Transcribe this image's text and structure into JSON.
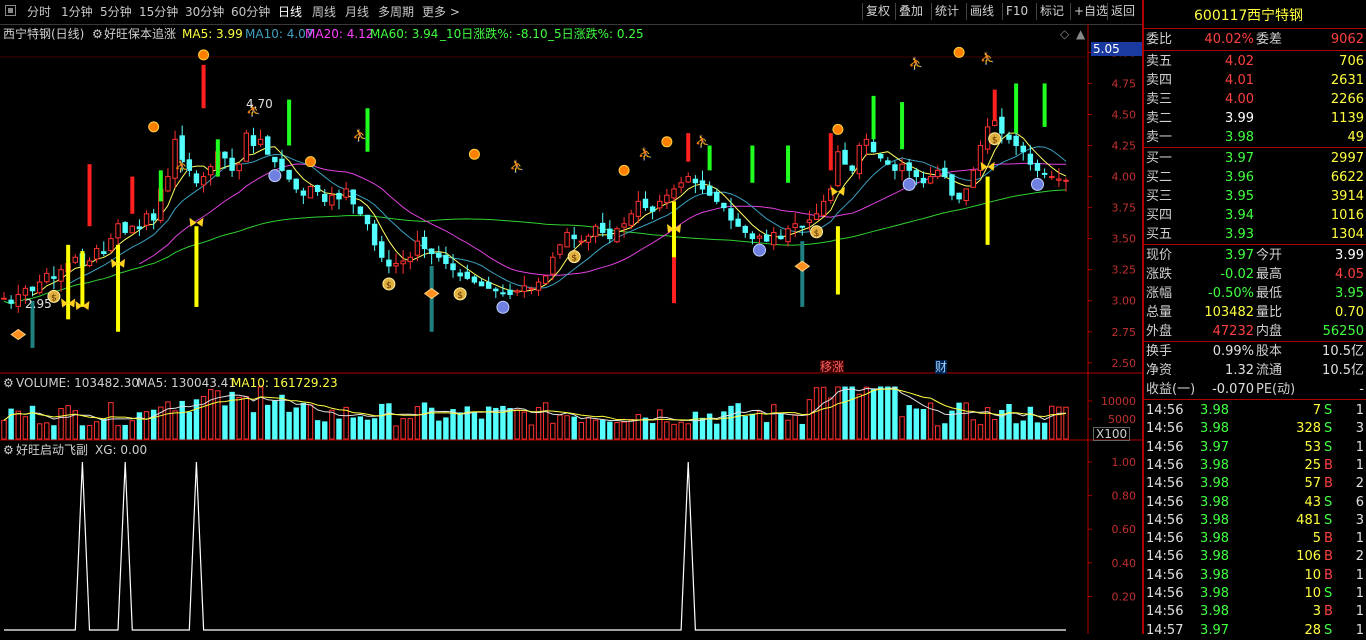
{
  "toolbar": {
    "periods": [
      "分时",
      "1分钟",
      "5分钟",
      "15分钟",
      "30分钟",
      "60分钟",
      "日线",
      "周线",
      "月线",
      "多周期",
      "更多"
    ],
    "active_period": "日线",
    "right_buttons": [
      "复权",
      "叠加",
      "统计",
      "画线",
      "F10",
      "标记",
      "+自选",
      "返回"
    ]
  },
  "main_chart": {
    "stock_title": "西宁特钢(日线)",
    "indicator_name": "好旺保本追涨",
    "ma_values": [
      {
        "label": "MA5: 3.99",
        "color": "#ffff40"
      },
      {
        "label": "MA10: 4.07",
        "color": "#40a0c0"
      },
      {
        "label": "MA20: 4.12",
        "color": "#ff40ff"
      },
      {
        "label": "MA60: 3.94",
        "color": "#40ff40"
      },
      {
        "label": "_10日涨跌%: -8.10",
        "color": "#40ff40"
      },
      {
        "label": "_5日涨跌%: 0.25",
        "color": "#40ff40"
      }
    ],
    "price_axis": [
      "5.00",
      "4.75",
      "4.50",
      "4.25",
      "4.00",
      "3.75",
      "3.50",
      "3.25",
      "3.00",
      "2.75",
      "2.50"
    ],
    "current_price_tag": "5.05",
    "high_label": "4.70",
    "low_label": "2.95",
    "event_tags": [
      "移涨",
      "财"
    ]
  },
  "volume_chart": {
    "title": "VOLUME: 103482.30",
    "ma5": "MA5: 130043.41",
    "ma10": "MA10: 161729.23",
    "axis": [
      "10000",
      "5000"
    ],
    "unit": "X100"
  },
  "sub_chart": {
    "title": "好旺启动飞副",
    "xg": "XG: 0.00",
    "axis": [
      "1.00",
      "0.80",
      "0.60",
      "0.40",
      "0.20"
    ]
  },
  "quote": {
    "code": "600117",
    "name": "西宁特钢",
    "weibi_label": "委比",
    "weibi_value": "40.02%",
    "weicha_label": "委差",
    "weicha_value": "9062",
    "asks": [
      {
        "label": "卖五",
        "price": "4.02",
        "vol": "706",
        "pc": "#ff4040"
      },
      {
        "label": "卖四",
        "price": "4.01",
        "vol": "2631",
        "pc": "#ff4040"
      },
      {
        "label": "卖三",
        "price": "4.00",
        "vol": "2266",
        "pc": "#ff4040"
      },
      {
        "label": "卖二",
        "price": "3.99",
        "vol": "1139",
        "pc": "#ffffff"
      },
      {
        "label": "卖一",
        "price": "3.98",
        "vol": "49",
        "pc": "#40ff40"
      }
    ],
    "bids": [
      {
        "label": "买一",
        "price": "3.97",
        "vol": "2997",
        "pc": "#40ff40"
      },
      {
        "label": "买二",
        "price": "3.96",
        "vol": "6622",
        "pc": "#40ff40"
      },
      {
        "label": "买三",
        "price": "3.95",
        "vol": "3914",
        "pc": "#40ff40"
      },
      {
        "label": "买四",
        "price": "3.94",
        "vol": "1016",
        "pc": "#40ff40"
      },
      {
        "label": "买五",
        "price": "3.93",
        "vol": "1304",
        "pc": "#40ff40"
      }
    ],
    "stats": [
      {
        "l1": "现价",
        "v1": "3.97",
        "c1": "#40ff40",
        "l2": "今开",
        "v2": "3.99",
        "c2": "#ffffff"
      },
      {
        "l1": "涨跌",
        "v1": "-0.02",
        "c1": "#40ff40",
        "l2": "最高",
        "v2": "4.05",
        "c2": "#ff4040"
      },
      {
        "l1": "涨幅",
        "v1": "-0.50%",
        "c1": "#40ff40",
        "l2": "最低",
        "v2": "3.95",
        "c2": "#40ff40"
      },
      {
        "l1": "总量",
        "v1": "103482",
        "c1": "#ffff40",
        "l2": "量比",
        "v2": "0.70",
        "c2": "#ffff40"
      },
      {
        "l1": "外盘",
        "v1": "47232",
        "c1": "#ff4040",
        "l2": "内盘",
        "v2": "56250",
        "c2": "#40ff40"
      }
    ],
    "stats2": [
      {
        "l1": "换手",
        "v1": "0.99%",
        "l2": "股本",
        "v2": "10.5亿"
      },
      {
        "l1": "净资",
        "v1": "1.32",
        "l2": "流通",
        "v2": "10.5亿"
      },
      {
        "l1": "收益(一)",
        "v1": "-0.070",
        "l2": "PE(动)",
        "v2": "-"
      }
    ],
    "ticks": [
      {
        "time": "14:56",
        "price": "3.98",
        "vol": "7",
        "bs": "S",
        "n": "1"
      },
      {
        "time": "14:56",
        "price": "3.98",
        "vol": "328",
        "bs": "S",
        "n": "3"
      },
      {
        "time": "14:56",
        "price": "3.97",
        "vol": "53",
        "bs": "S",
        "n": "1"
      },
      {
        "time": "14:56",
        "price": "3.98",
        "vol": "25",
        "bs": "B",
        "n": "1"
      },
      {
        "time": "14:56",
        "price": "3.98",
        "vol": "57",
        "bs": "B",
        "n": "2"
      },
      {
        "time": "14:56",
        "price": "3.98",
        "vol": "43",
        "bs": "S",
        "n": "6"
      },
      {
        "time": "14:56",
        "price": "3.98",
        "vol": "481",
        "bs": "S",
        "n": "3"
      },
      {
        "time": "14:56",
        "price": "3.98",
        "vol": "5",
        "bs": "B",
        "n": "1"
      },
      {
        "time": "14:56",
        "price": "3.98",
        "vol": "106",
        "bs": "B",
        "n": "2"
      },
      {
        "time": "14:56",
        "price": "3.98",
        "vol": "10",
        "bs": "B",
        "n": "1"
      },
      {
        "time": "14:56",
        "price": "3.98",
        "vol": "10",
        "bs": "S",
        "n": "1"
      },
      {
        "time": "14:56",
        "price": "3.98",
        "vol": "3",
        "bs": "B",
        "n": "1"
      },
      {
        "time": "14:57",
        "price": "3.97",
        "vol": "28",
        "bs": "S",
        "n": "1"
      }
    ]
  },
  "chart_data": {
    "type": "candlestick",
    "price_range": [
      2.45,
      5.1
    ],
    "close": [
      3.02,
      2.98,
      3.05,
      3.1,
      3.08,
      3.15,
      3.22,
      3.18,
      3.25,
      3.3,
      3.35,
      3.28,
      3.32,
      3.42,
      3.38,
      3.5,
      3.62,
      3.55,
      3.6,
      3.58,
      3.7,
      3.65,
      3.9,
      4.0,
      4.3,
      4.12,
      4.05,
      3.95,
      4.0,
      4.08,
      4.2,
      4.15,
      4.05,
      4.1,
      4.35,
      4.25,
      4.3,
      4.18,
      4.12,
      4.05,
      3.98,
      3.9,
      3.85,
      3.92,
      3.88,
      3.8,
      3.85,
      3.82,
      3.9,
      3.78,
      3.7,
      3.62,
      3.45,
      3.35,
      3.28,
      3.3,
      3.32,
      3.35,
      3.48,
      3.42,
      3.38,
      3.35,
      3.3,
      3.25,
      3.2,
      3.18,
      3.15,
      3.12,
      3.1,
      3.08,
      3.06,
      3.05,
      3.08,
      3.12,
      3.1,
      3.15,
      3.2,
      3.35,
      3.45,
      3.55,
      3.5,
      3.48,
      3.52,
      3.6,
      3.55,
      3.5,
      3.58,
      3.62,
      3.7,
      3.8,
      3.75,
      3.72,
      3.8,
      3.85,
      3.9,
      3.95,
      4.0,
      3.95,
      3.9,
      3.85,
      3.8,
      3.75,
      3.65,
      3.6,
      3.55,
      3.5,
      3.52,
      3.48,
      3.55,
      3.5,
      3.58,
      3.62,
      3.6,
      3.65,
      3.7,
      3.8,
      3.9,
      4.2,
      4.1,
      4.05,
      4.25,
      4.3,
      4.2,
      4.15,
      4.1,
      4.05,
      4.1,
      4.05,
      4.0,
      3.95,
      4.0,
      4.05,
      4.0,
      3.85,
      3.82,
      3.9,
      4.05,
      4.25,
      4.4,
      4.45,
      4.35,
      4.3,
      4.25,
      4.2,
      4.1,
      4.05,
      4.02,
      4.0,
      3.98,
      3.97
    ],
    "markers": [
      {
        "i": 2,
        "type": "diamond"
      },
      {
        "i": 7,
        "type": "money"
      },
      {
        "i": 9,
        "type": "butterfly"
      },
      {
        "i": 11,
        "type": "butterfly"
      },
      {
        "i": 16,
        "type": "butterfly"
      },
      {
        "i": 27,
        "type": "butterfly"
      },
      {
        "i": 38,
        "type": "face"
      },
      {
        "i": 54,
        "type": "money"
      },
      {
        "i": 60,
        "type": "diamond"
      },
      {
        "i": 64,
        "type": "money"
      },
      {
        "i": 70,
        "type": "face"
      },
      {
        "i": 80,
        "type": "money"
      },
      {
        "i": 94,
        "type": "butterfly"
      },
      {
        "i": 106,
        "type": "face"
      },
      {
        "i": 112,
        "type": "diamond"
      },
      {
        "i": 114,
        "type": "money"
      },
      {
        "i": 117,
        "type": "butterfly"
      },
      {
        "i": 127,
        "type": "face"
      },
      {
        "i": 138,
        "type": "butterfly"
      },
      {
        "i": 139,
        "type": "money"
      },
      {
        "i": 145,
        "type": "face"
      }
    ],
    "xg_peaks": [
      11,
      17,
      27,
      96
    ]
  }
}
